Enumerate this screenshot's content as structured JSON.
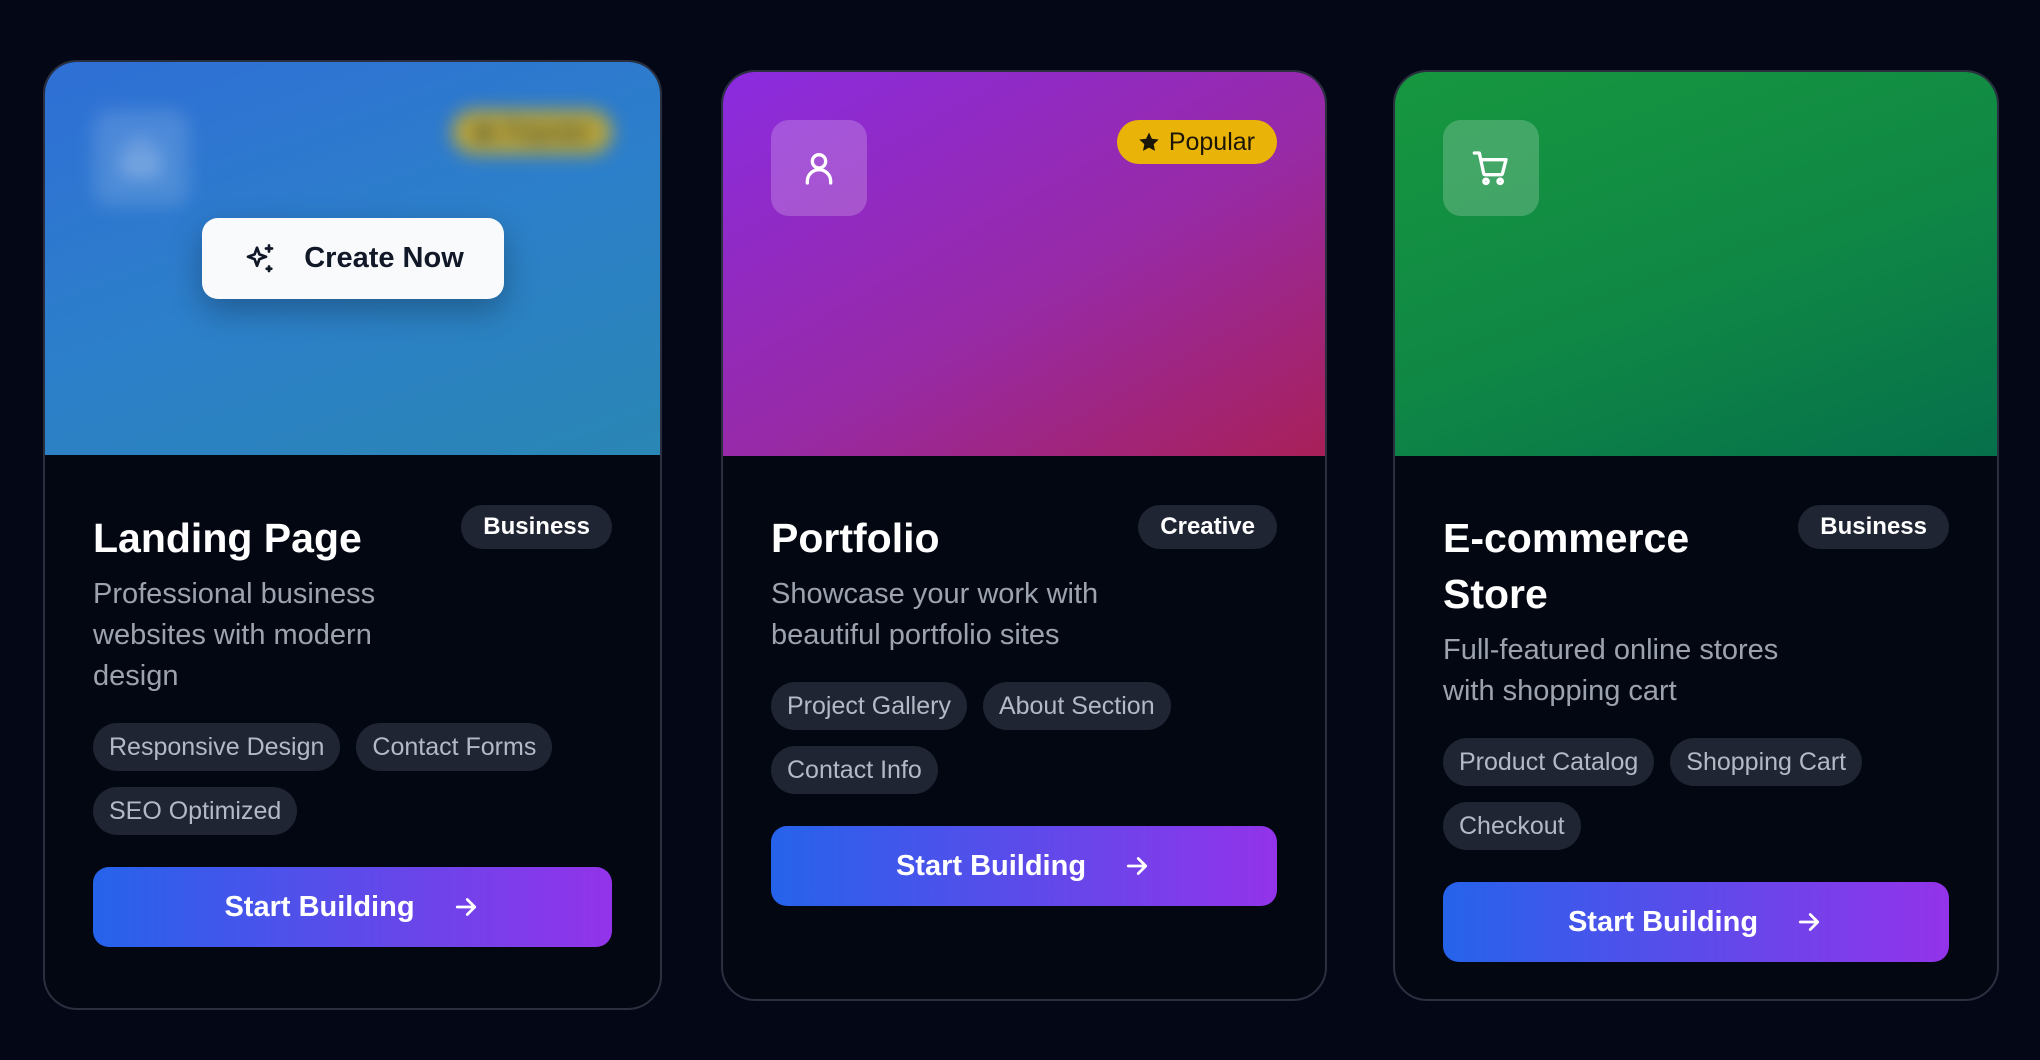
{
  "templates": [
    {
      "title": "Landing Page",
      "category": "Business",
      "description": "Professional business websites with modern design",
      "features": [
        "Responsive Design",
        "Contact Forms",
        "SEO Optimized"
      ],
      "cta_label": "Start Building",
      "hover_label": "Create Now",
      "popular_label": "Popular",
      "icon": "home-icon",
      "gradient": [
        "#2f6fd6",
        "#2a86b4"
      ]
    },
    {
      "title": "Portfolio",
      "category": "Creative",
      "description": "Showcase your work with beautiful portfolio sites",
      "features": [
        "Project Gallery",
        "About Section",
        "Contact Info"
      ],
      "cta_label": "Start Building",
      "popular_label": "Popular",
      "icon": "user-icon",
      "gradient": [
        "#8b2be0",
        "#a82058"
      ]
    },
    {
      "title": "E-commerce Store",
      "category": "Business",
      "description": "Full-featured online stores with shopping cart",
      "features": [
        "Product Catalog",
        "Shopping Cart",
        "Checkout"
      ],
      "cta_label": "Start Building",
      "icon": "cart-icon",
      "gradient": [
        "#17973f",
        "#06704b"
      ]
    }
  ],
  "colors": {
    "background": "#040816",
    "card": "#030712",
    "popular_badge": "#eab308",
    "cta_gradient": [
      "#2563eb",
      "#9333ea"
    ]
  }
}
